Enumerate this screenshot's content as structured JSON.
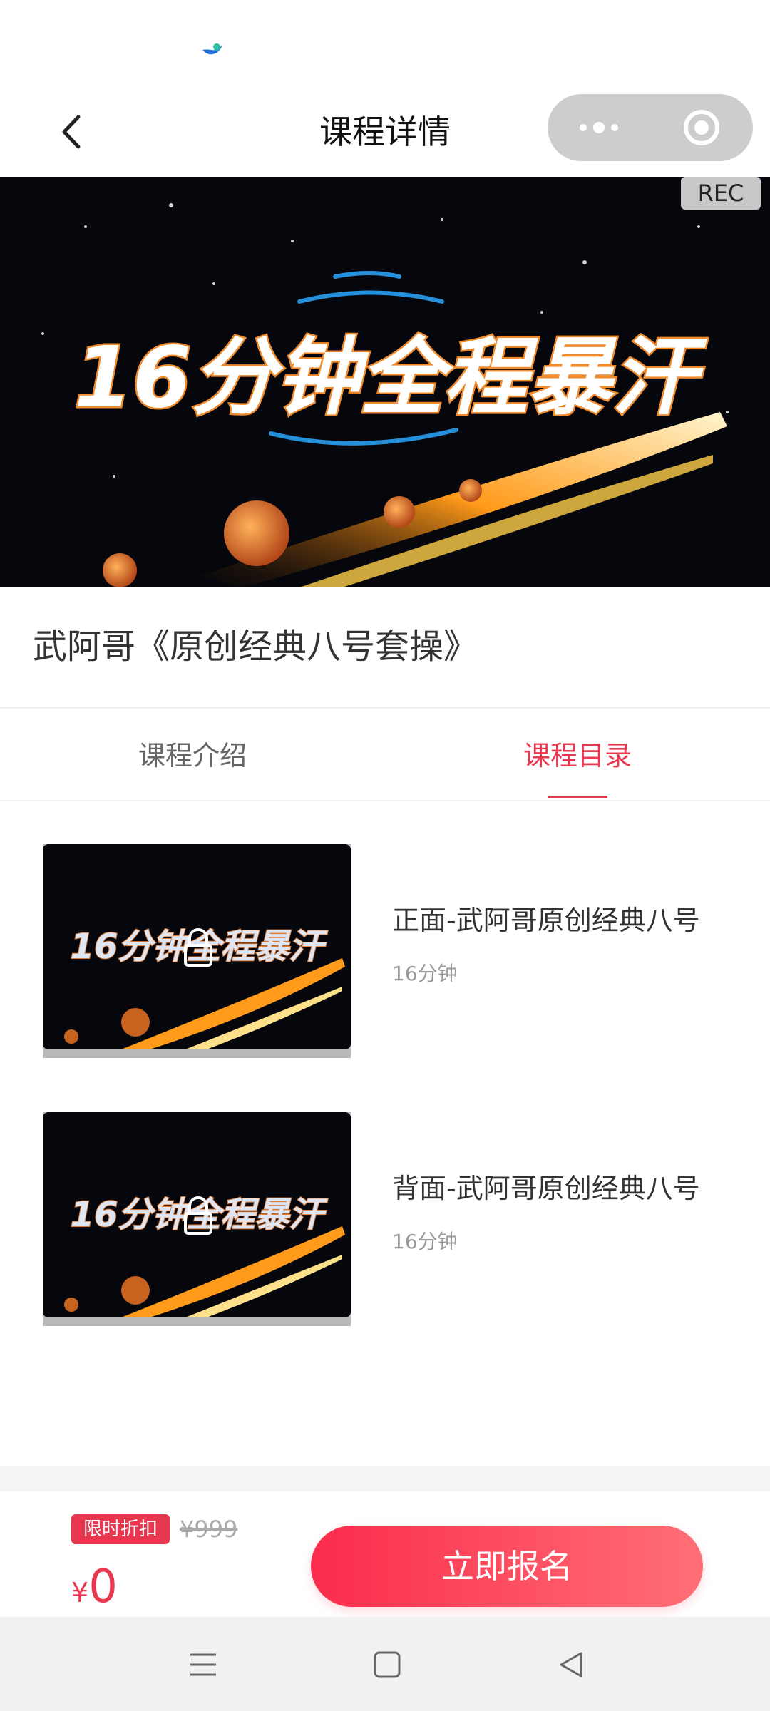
{
  "nav": {
    "title": "课程详情"
  },
  "banner": {
    "headline": "16分钟全程暴汗",
    "rec_label": "REC"
  },
  "course": {
    "title": "武阿哥《原创经典八号套操》"
  },
  "tabs": [
    {
      "label": "课程介绍",
      "active": false
    },
    {
      "label": "课程目录",
      "active": true
    }
  ],
  "lessons": [
    {
      "title": "正面-武阿哥原创经典八号",
      "duration": "16分钟",
      "thumb_text": "16分钟全程暴汗"
    },
    {
      "title": "背面-武阿哥原创经典八号",
      "duration": "16分钟",
      "thumb_text": "16分钟全程暴汗"
    }
  ],
  "purchase": {
    "badge": "限时折扣",
    "original_price": "¥999",
    "currency": "¥",
    "price": "0",
    "button": "立即报名"
  },
  "colors": {
    "accent": "#e8384f",
    "banner_bg": "#06070d"
  },
  "icons": {
    "back": "chevron-left-icon",
    "more": "more-dots-icon",
    "close": "target-close-icon",
    "lock": "lock-icon",
    "menu": "menu-icon",
    "home": "square-home-icon",
    "nav_back": "triangle-back-icon"
  }
}
